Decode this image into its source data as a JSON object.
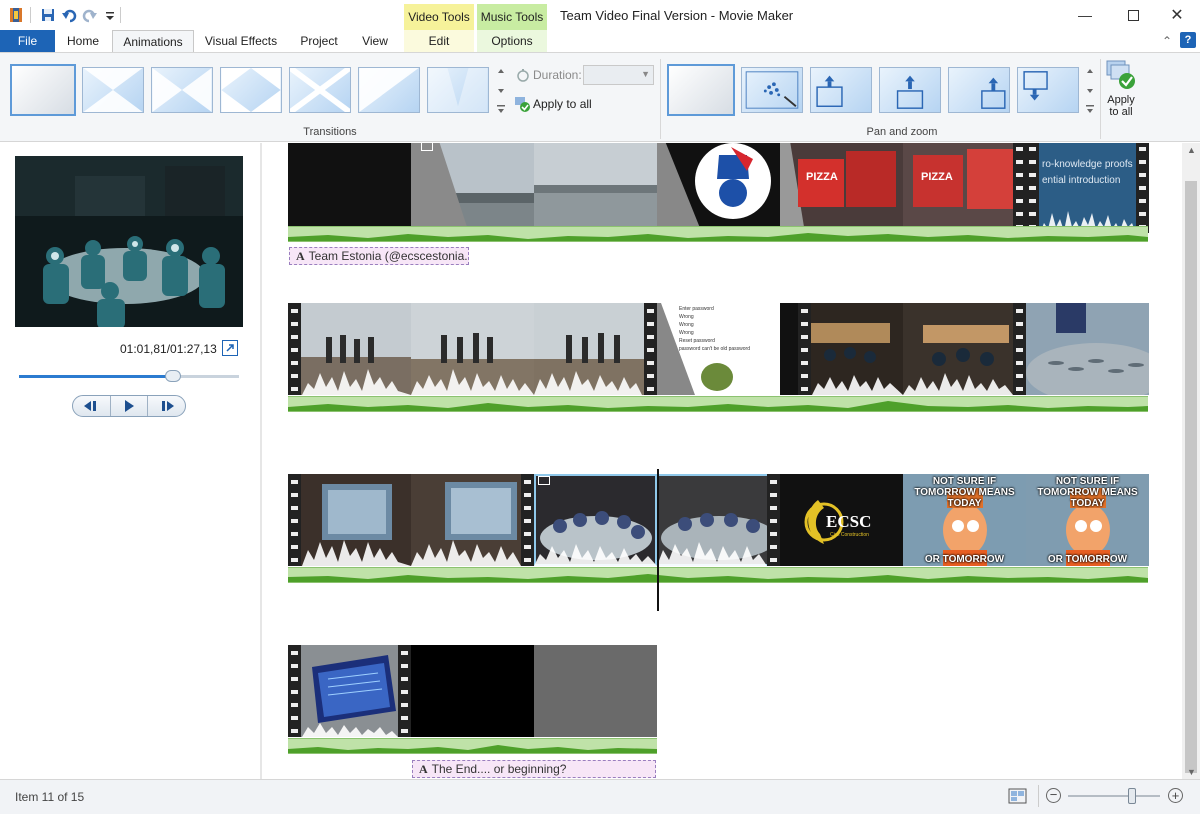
{
  "window": {
    "title": "Team Video Final Version - Movie Maker",
    "contextual_video": "Video Tools",
    "contextual_music": "Music Tools"
  },
  "tabs": {
    "file": "File",
    "home": "Home",
    "animations": "Animations",
    "visual_effects": "Visual Effects",
    "project": "Project",
    "view": "View",
    "edit": "Edit",
    "options": "Options"
  },
  "ribbon": {
    "transitions_label": "Transitions",
    "duration_label": "Duration:",
    "duration_value": "",
    "apply_to_all_small": "Apply to all",
    "pan_zoom_label": "Pan and zoom",
    "apply_to_all_big_line1": "Apply",
    "apply_to_all_big_line2": "to all"
  },
  "preview": {
    "timecode": "01:01,81/01:27,13",
    "seek_progress": 0.7
  },
  "storyboard": {
    "rows": [
      {
        "caption": "Team Estonia (@ecscestonia..."
      },
      {
        "caption": ""
      },
      {
        "caption": ""
      },
      {
        "caption": "The End.... or beginning?"
      }
    ],
    "thumb_texts": {
      "zkp_line1": "ro-knowledge proofs",
      "zkp_line2": "ential introduction",
      "pizza": "PIZZA",
      "ecsc": "ECSC",
      "ecsc_sub": "Civil Construction",
      "meme_top": "NOT SURE IF TOMORROW MEANS TODAY",
      "meme_bottom": "OR TOMORROW",
      "pw_lines": [
        "Enter password",
        "Wrong",
        "Wrong",
        "Wrong",
        "Reset password",
        "password can't be old password"
      ]
    }
  },
  "status": {
    "item": "Item 11 of 15",
    "zoom_level": 0.7
  },
  "colors": {
    "accent": "#1d64b6",
    "video_tools": "#f6f29a",
    "music_tools": "#c8eca2",
    "audio": "#bfe2a8",
    "caption": "#f7e6f7"
  }
}
